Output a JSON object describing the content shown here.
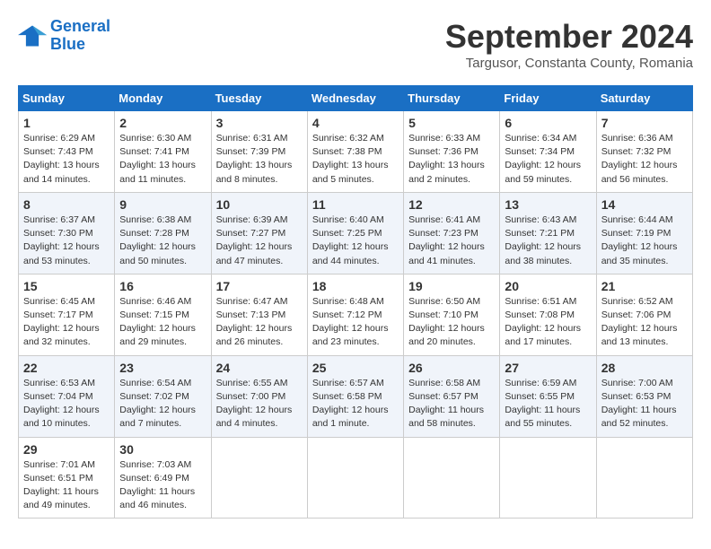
{
  "logo": {
    "line1": "General",
    "line2": "Blue"
  },
  "title": "September 2024",
  "subtitle": "Targusor, Constanta County, Romania",
  "headers": [
    "Sunday",
    "Monday",
    "Tuesday",
    "Wednesday",
    "Thursday",
    "Friday",
    "Saturday"
  ],
  "weeks": [
    [
      {
        "day": "1",
        "info": "Sunrise: 6:29 AM\nSunset: 7:43 PM\nDaylight: 13 hours\nand 14 minutes."
      },
      {
        "day": "2",
        "info": "Sunrise: 6:30 AM\nSunset: 7:41 PM\nDaylight: 13 hours\nand 11 minutes."
      },
      {
        "day": "3",
        "info": "Sunrise: 6:31 AM\nSunset: 7:39 PM\nDaylight: 13 hours\nand 8 minutes."
      },
      {
        "day": "4",
        "info": "Sunrise: 6:32 AM\nSunset: 7:38 PM\nDaylight: 13 hours\nand 5 minutes."
      },
      {
        "day": "5",
        "info": "Sunrise: 6:33 AM\nSunset: 7:36 PM\nDaylight: 13 hours\nand 2 minutes."
      },
      {
        "day": "6",
        "info": "Sunrise: 6:34 AM\nSunset: 7:34 PM\nDaylight: 12 hours\nand 59 minutes."
      },
      {
        "day": "7",
        "info": "Sunrise: 6:36 AM\nSunset: 7:32 PM\nDaylight: 12 hours\nand 56 minutes."
      }
    ],
    [
      {
        "day": "8",
        "info": "Sunrise: 6:37 AM\nSunset: 7:30 PM\nDaylight: 12 hours\nand 53 minutes."
      },
      {
        "day": "9",
        "info": "Sunrise: 6:38 AM\nSunset: 7:28 PM\nDaylight: 12 hours\nand 50 minutes."
      },
      {
        "day": "10",
        "info": "Sunrise: 6:39 AM\nSunset: 7:27 PM\nDaylight: 12 hours\nand 47 minutes."
      },
      {
        "day": "11",
        "info": "Sunrise: 6:40 AM\nSunset: 7:25 PM\nDaylight: 12 hours\nand 44 minutes."
      },
      {
        "day": "12",
        "info": "Sunrise: 6:41 AM\nSunset: 7:23 PM\nDaylight: 12 hours\nand 41 minutes."
      },
      {
        "day": "13",
        "info": "Sunrise: 6:43 AM\nSunset: 7:21 PM\nDaylight: 12 hours\nand 38 minutes."
      },
      {
        "day": "14",
        "info": "Sunrise: 6:44 AM\nSunset: 7:19 PM\nDaylight: 12 hours\nand 35 minutes."
      }
    ],
    [
      {
        "day": "15",
        "info": "Sunrise: 6:45 AM\nSunset: 7:17 PM\nDaylight: 12 hours\nand 32 minutes."
      },
      {
        "day": "16",
        "info": "Sunrise: 6:46 AM\nSunset: 7:15 PM\nDaylight: 12 hours\nand 29 minutes."
      },
      {
        "day": "17",
        "info": "Sunrise: 6:47 AM\nSunset: 7:13 PM\nDaylight: 12 hours\nand 26 minutes."
      },
      {
        "day": "18",
        "info": "Sunrise: 6:48 AM\nSunset: 7:12 PM\nDaylight: 12 hours\nand 23 minutes."
      },
      {
        "day": "19",
        "info": "Sunrise: 6:50 AM\nSunset: 7:10 PM\nDaylight: 12 hours\nand 20 minutes."
      },
      {
        "day": "20",
        "info": "Sunrise: 6:51 AM\nSunset: 7:08 PM\nDaylight: 12 hours\nand 17 minutes."
      },
      {
        "day": "21",
        "info": "Sunrise: 6:52 AM\nSunset: 7:06 PM\nDaylight: 12 hours\nand 13 minutes."
      }
    ],
    [
      {
        "day": "22",
        "info": "Sunrise: 6:53 AM\nSunset: 7:04 PM\nDaylight: 12 hours\nand 10 minutes."
      },
      {
        "day": "23",
        "info": "Sunrise: 6:54 AM\nSunset: 7:02 PM\nDaylight: 12 hours\nand 7 minutes."
      },
      {
        "day": "24",
        "info": "Sunrise: 6:55 AM\nSunset: 7:00 PM\nDaylight: 12 hours\nand 4 minutes."
      },
      {
        "day": "25",
        "info": "Sunrise: 6:57 AM\nSunset: 6:58 PM\nDaylight: 12 hours\nand 1 minute."
      },
      {
        "day": "26",
        "info": "Sunrise: 6:58 AM\nSunset: 6:57 PM\nDaylight: 11 hours\nand 58 minutes."
      },
      {
        "day": "27",
        "info": "Sunrise: 6:59 AM\nSunset: 6:55 PM\nDaylight: 11 hours\nand 55 minutes."
      },
      {
        "day": "28",
        "info": "Sunrise: 7:00 AM\nSunset: 6:53 PM\nDaylight: 11 hours\nand 52 minutes."
      }
    ],
    [
      {
        "day": "29",
        "info": "Sunrise: 7:01 AM\nSunset: 6:51 PM\nDaylight: 11 hours\nand 49 minutes."
      },
      {
        "day": "30",
        "info": "Sunrise: 7:03 AM\nSunset: 6:49 PM\nDaylight: 11 hours\nand 46 minutes."
      },
      null,
      null,
      null,
      null,
      null
    ]
  ]
}
